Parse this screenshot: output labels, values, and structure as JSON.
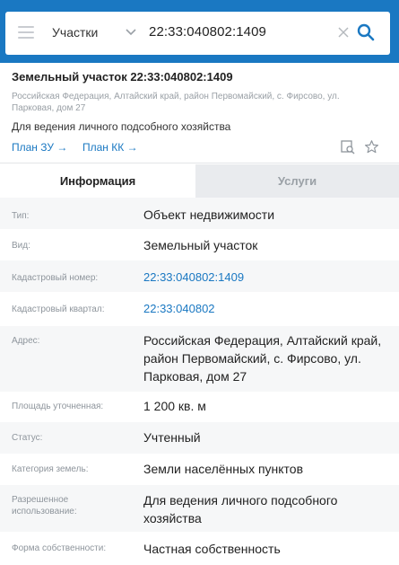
{
  "search": {
    "category": "Участки",
    "query": "22:33:040802:1409"
  },
  "object": {
    "title": "Земельный участок 22:33:040802:1409",
    "address": "Российская Федерация, Алтайский край, район Первомайский, с. Фирсово, ул. Парковая, дом 27",
    "purpose": "Для ведения личного подсобного хозяйства",
    "link_plan_zu": "План ЗУ →",
    "link_plan_kk": "План КК →"
  },
  "tabs": {
    "info": "Информация",
    "services": "Услуги"
  },
  "info": {
    "type_label": "Тип:",
    "type_value": "Объект недвижимости",
    "kind_label": "Вид:",
    "kind_value": "Земельный участок",
    "cadnum_label": "Кадастровый номер:",
    "cadnum_value": "22:33:040802:1409",
    "quarter_label": "Кадастровый квартал:",
    "quarter_value": "22:33:040802",
    "address_label": "Адрес:",
    "address_value": "Российская Федерация, Алтайский край, район Первомайский, с. Фирсово, ул. Парковая, дом 27",
    "area_label": "Площадь уточненная:",
    "area_value": "1 200 кв. м",
    "status_label": "Статус:",
    "status_value": "Учтенный",
    "category_label": "Категория земель:",
    "category_value": "Земли населённых пунктов",
    "use_label": "Разрешенное использование:",
    "use_value": "Для ведения личного подсобного хозяйства",
    "ownership_label": "Форма собственности:",
    "ownership_value": "Частная собственность"
  },
  "icons": {
    "menu": "menu-icon",
    "chevron": "chevron-down-icon",
    "clear": "close-icon",
    "search": "search-icon",
    "map": "map-search-icon",
    "favorite": "star-icon"
  },
  "colors": {
    "brand": "#1a78c2",
    "muted": "#8e959c",
    "tab_inactive_bg": "#e9ebee"
  }
}
